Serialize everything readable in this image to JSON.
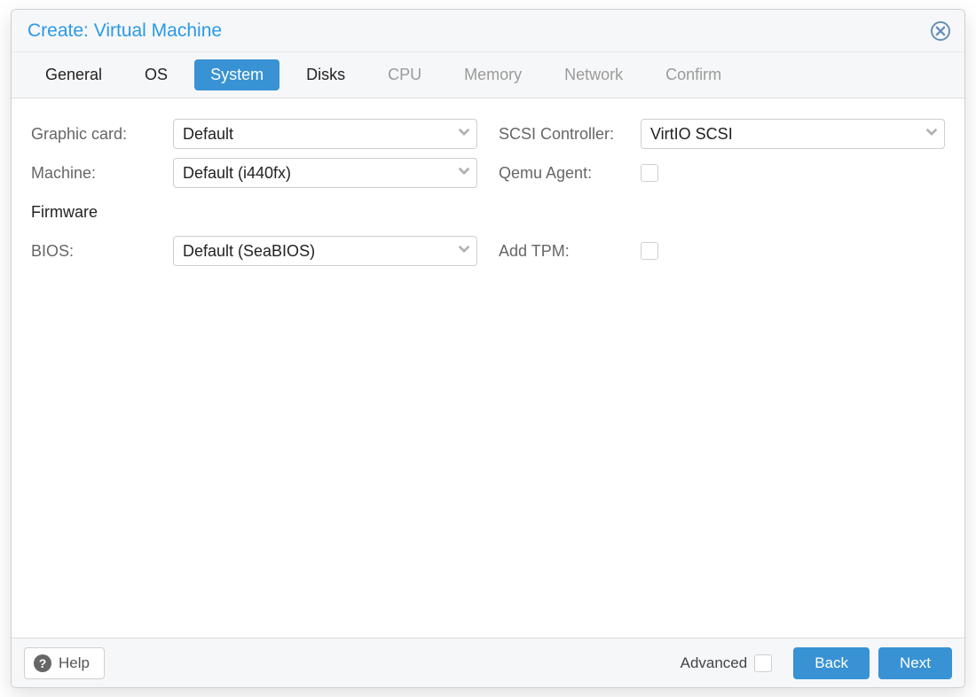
{
  "title": "Create: Virtual Machine",
  "tabs": [
    {
      "label": "General",
      "state": "done"
    },
    {
      "label": "OS",
      "state": "done"
    },
    {
      "label": "System",
      "state": "active"
    },
    {
      "label": "Disks",
      "state": "done"
    },
    {
      "label": "CPU",
      "state": "disabled"
    },
    {
      "label": "Memory",
      "state": "disabled"
    },
    {
      "label": "Network",
      "state": "disabled"
    },
    {
      "label": "Confirm",
      "state": "disabled"
    }
  ],
  "form": {
    "graphic_card": {
      "label": "Graphic card:",
      "value": "Default"
    },
    "machine": {
      "label": "Machine:",
      "value": "Default (i440fx)"
    },
    "firmware_section": "Firmware",
    "bios": {
      "label": "BIOS:",
      "value": "Default (SeaBIOS)"
    },
    "scsi": {
      "label": "SCSI Controller:",
      "value": "VirtIO SCSI"
    },
    "qemu_agent": {
      "label": "Qemu Agent:",
      "checked": false
    },
    "add_tpm": {
      "label": "Add TPM:",
      "checked": false
    }
  },
  "footer": {
    "help": "Help",
    "advanced": "Advanced",
    "back": "Back",
    "next": "Next"
  }
}
